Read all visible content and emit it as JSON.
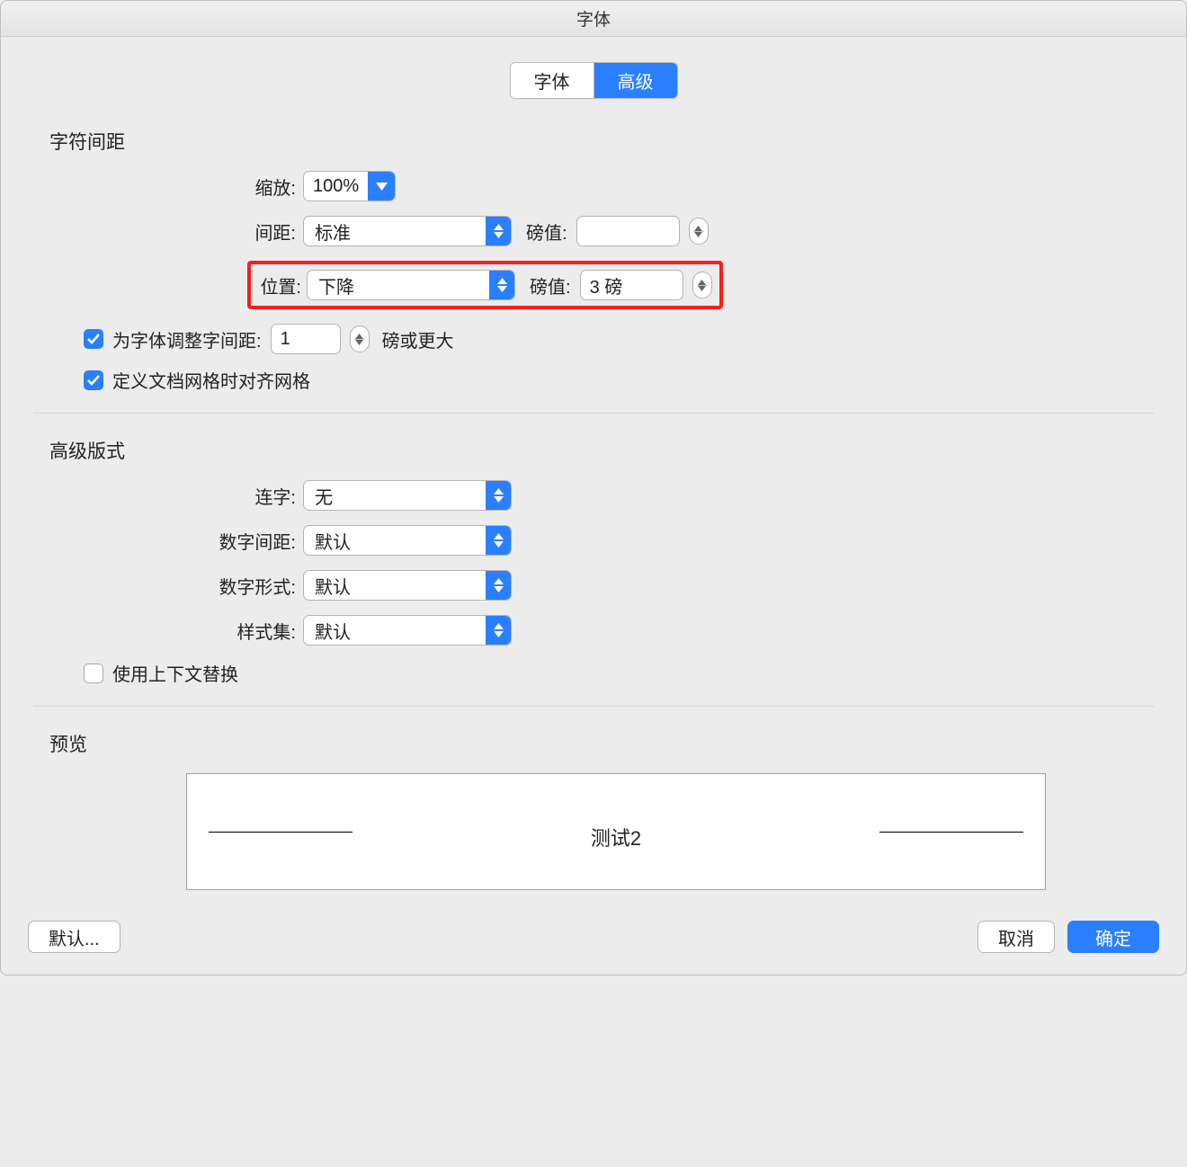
{
  "window_title": "字体",
  "tabs": {
    "font": "字体",
    "advanced": "高级"
  },
  "section_char_spacing": "字符间距",
  "labels": {
    "scale": "缩放:",
    "spacing": "间距:",
    "pt1": "磅值:",
    "position": "位置:",
    "pt2": "磅值:",
    "kerning_checkbox": "为字体调整字间距:",
    "kerning_suffix": "磅或更大",
    "snap_grid": "定义文档网格时对齐网格",
    "ligature": "连字:",
    "num_spacing": "数字间距:",
    "num_form": "数字形式:",
    "style_set": "样式集:",
    "contextual": "使用上下文替换"
  },
  "values": {
    "scale": "100%",
    "spacing": "标准",
    "spacing_pt": "",
    "position": "下降",
    "position_pt": "3 磅",
    "kerning_value": "1",
    "ligature": "无",
    "num_spacing": "默认",
    "num_form": "默认",
    "style_set": "默认"
  },
  "section_typography": "高级版式",
  "preview_title": "预览",
  "preview_text": "测试2",
  "buttons": {
    "default": "默认...",
    "cancel": "取消",
    "ok": "确定"
  }
}
